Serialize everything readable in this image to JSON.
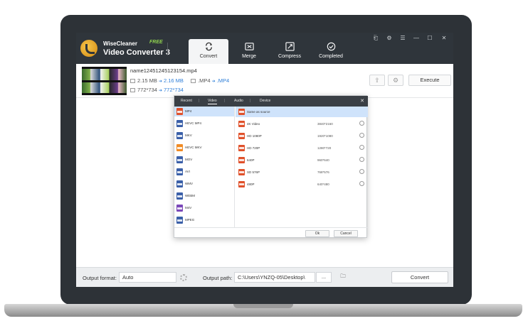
{
  "app": {
    "brand_name": "WiseCleaner",
    "brand_badge": "FREE",
    "product_name": "Video Converter 3"
  },
  "tabs": [
    {
      "label": "Convert",
      "icon": "convert-icon",
      "active": true
    },
    {
      "label": "Merge",
      "icon": "merge-icon",
      "active": false
    },
    {
      "label": "Compress",
      "icon": "compress-icon",
      "active": false
    },
    {
      "label": "Completed",
      "icon": "completed-icon",
      "active": false
    }
  ],
  "window_controls": [
    "pin-icon",
    "settings-icon",
    "menu-icon",
    "minimize-icon",
    "maximize-icon",
    "close-icon"
  ],
  "file": {
    "name": "name12451245123154.mp4",
    "size_from": "2.15 MB",
    "size_to": "2.16 MB",
    "format_from": ".MP4",
    "format_to": ".MP4",
    "res_from": "772*734",
    "res_to": "772*734",
    "execute_label": "Execute"
  },
  "dialog": {
    "tabs": [
      "Recent",
      "Video",
      "Audio",
      "Device"
    ],
    "active_tab": "Video",
    "formats": [
      {
        "label": "MP4",
        "color": "#e0512b",
        "selected": true
      },
      {
        "label": "HEVC MP4",
        "color": "#3a5fa8",
        "selected": false
      },
      {
        "label": "MKV",
        "color": "#3a5fa8",
        "selected": false
      },
      {
        "label": "HEVC MKV",
        "color": "#f08a24",
        "selected": false
      },
      {
        "label": "MOV",
        "color": "#3a5fa8",
        "selected": false
      },
      {
        "label": "AVI",
        "color": "#3a5fa8",
        "selected": false
      },
      {
        "label": "WMV",
        "color": "#3a5fa8",
        "selected": false
      },
      {
        "label": "WEBM",
        "color": "#3a5fa8",
        "selected": false
      },
      {
        "label": "M4V",
        "color": "#7b48b8",
        "selected": false
      },
      {
        "label": "MPEG",
        "color": "#3a5fa8",
        "selected": false
      }
    ],
    "resolutions": [
      {
        "label": "Same as source",
        "dims": "",
        "selected": true
      },
      {
        "label": "4K Video",
        "dims": "3840*2160",
        "selected": false
      },
      {
        "label": "HD 1080P",
        "dims": "1920*1080",
        "selected": false
      },
      {
        "label": "HD 720P",
        "dims": "1280*720",
        "selected": false
      },
      {
        "label": "640P",
        "dims": "960*640",
        "selected": false
      },
      {
        "label": "SD 576P",
        "dims": "768*576",
        "selected": false
      },
      {
        "label": "480P",
        "dims": "640*480",
        "selected": false
      }
    ],
    "ok_label": "Ok",
    "cancel_label": "Cancel"
  },
  "bottom": {
    "output_format_label": "Output format:",
    "output_format_value": "Auto",
    "output_path_label": "Output path:",
    "output_path_value": "C:\\Users\\YNZQ-05\\Desktop\\",
    "browse_label": "...",
    "convert_label": "Convert"
  }
}
